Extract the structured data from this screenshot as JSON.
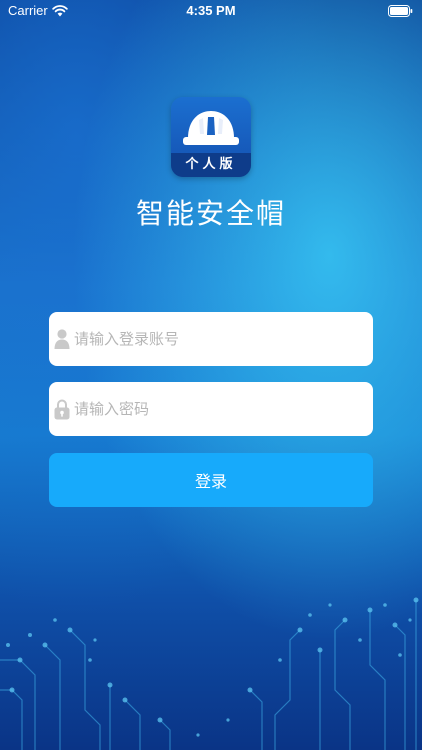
{
  "status_bar": {
    "carrier": "Carrier",
    "time": "4:35 PM"
  },
  "app": {
    "logo_badge": "个人版",
    "title": "智能安全帽"
  },
  "login_form": {
    "account_placeholder": "请输入登录账号",
    "password_placeholder": "请输入密码",
    "submit_label": "登录"
  },
  "icons": {
    "wifi": "wifi-icon",
    "battery": "battery-icon",
    "helmet": "helmet-icon",
    "user": "user-icon",
    "lock": "lock-icon"
  },
  "colors": {
    "primary_button": "#17aafb",
    "field_background": "#ffffff",
    "placeholder_text": "#b6b6b6",
    "title_text": "#ffffff"
  }
}
